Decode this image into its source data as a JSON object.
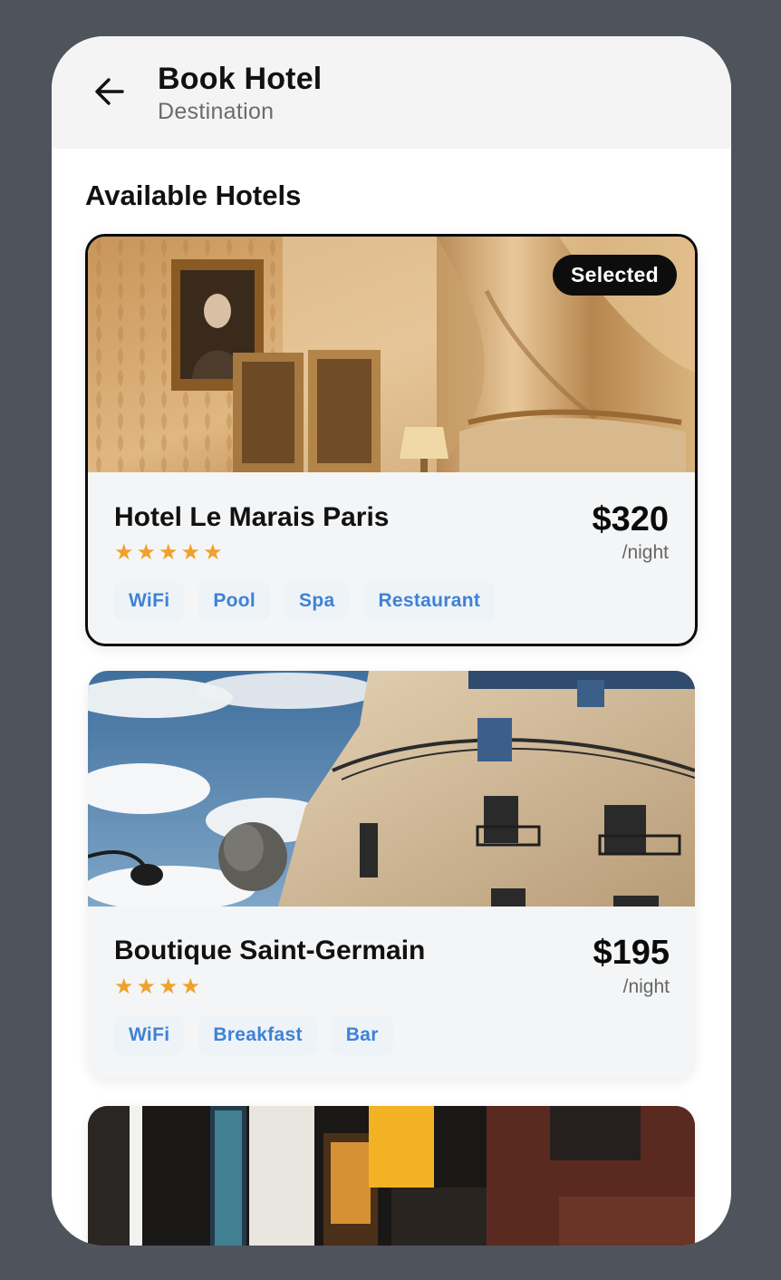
{
  "header": {
    "title": "Book Hotel",
    "subtitle": "Destination",
    "back_icon": "arrow-left-icon"
  },
  "section_title": "Available Hotels",
  "hotels": [
    {
      "name": "Hotel Le Marais Paris",
      "stars": "★★★★★",
      "rating": 5,
      "price": "$320",
      "per_night": "/night",
      "badge": "Selected",
      "amenities": [
        "WiFi",
        "Pool",
        "Spa",
        "Restaurant"
      ]
    },
    {
      "name": "Boutique Saint-Germain",
      "stars": "★★★★",
      "rating": 4,
      "price": "$195",
      "per_night": "/night",
      "amenities": [
        "WiFi",
        "Breakfast",
        "Bar"
      ]
    },
    {
      "name": "",
      "amenities": []
    }
  ],
  "colors": {
    "background": "#4f535c",
    "header_bg": "#f4f4f5",
    "card_bg": "#f4f5f6",
    "star": "#f0a12a",
    "chip_text": "#3d82d6",
    "chip_bg": "#eef3f8",
    "selected_border": "#0b0b0b"
  }
}
